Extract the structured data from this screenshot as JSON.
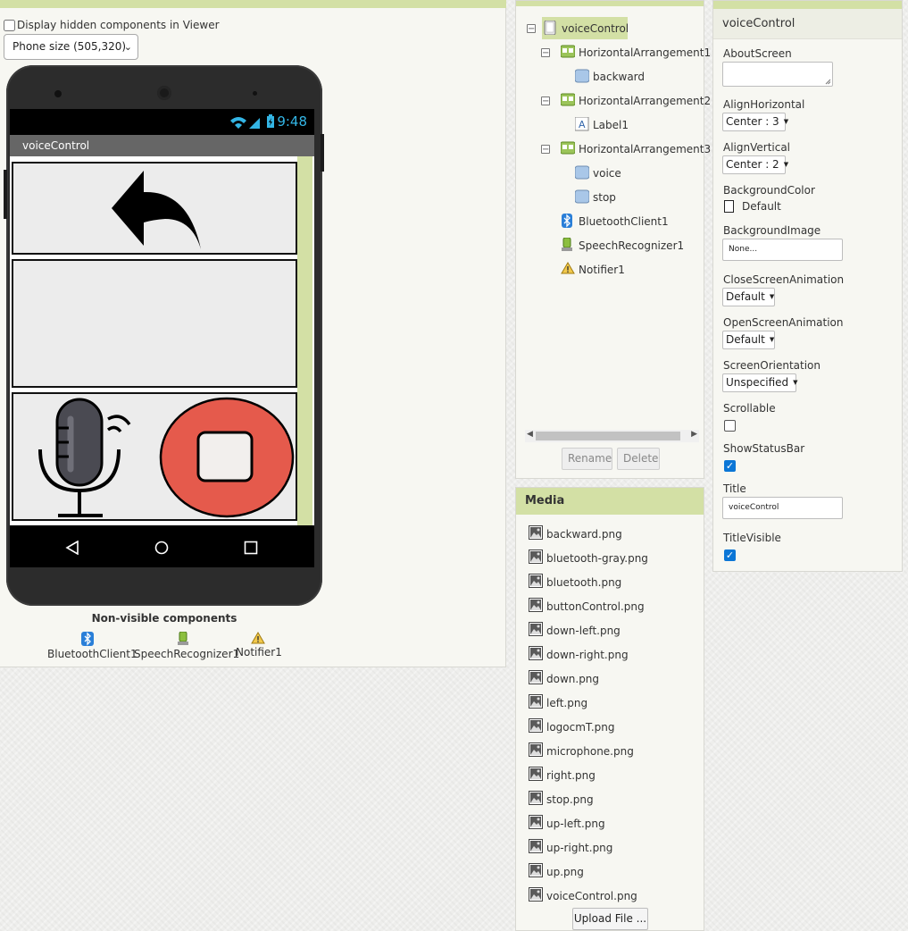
{
  "viewer": {
    "hidden_components_label": "Display hidden components in Viewer",
    "phone_size": "Phone size (505,320)",
    "status_time": "9:48",
    "screen_title": "voiceControl",
    "nonvisible_title": "Non-visible components",
    "nonvisible": [
      {
        "label": "BluetoothClient1",
        "icon": "bluetooth-icon"
      },
      {
        "label": "SpeechRecognizer1",
        "icon": "speech-icon"
      },
      {
        "label": "Notifier1",
        "icon": "warning-icon"
      }
    ],
    "images": {
      "backward": "backward-arrow-icon",
      "voice": "microphone-icon",
      "stop": "stop-icon"
    },
    "colors": {
      "accent_green": "#d3e0a5",
      "status_blue": "#33b5e5",
      "stop_red": "#e55a4c"
    }
  },
  "components": {
    "tree": [
      {
        "label": "voiceControl",
        "level": 0,
        "icon": "screen-icon",
        "toggle": "⊟"
      },
      {
        "label": "HorizontalArrangement1",
        "level": 1,
        "icon": "arrangement-icon",
        "toggle": "⊟"
      },
      {
        "label": "backward",
        "level": 2,
        "icon": "button-icon"
      },
      {
        "label": "HorizontalArrangement2",
        "level": 1,
        "icon": "arrangement-icon",
        "toggle": "⊟"
      },
      {
        "label": "Label1",
        "level": 2,
        "icon": "label-icon"
      },
      {
        "label": "HorizontalArrangement3",
        "level": 1,
        "icon": "arrangement-icon",
        "toggle": "⊟"
      },
      {
        "label": "voice",
        "level": 2,
        "icon": "button-icon"
      },
      {
        "label": "stop",
        "level": 2,
        "icon": "button-icon"
      },
      {
        "label": "BluetoothClient1",
        "level": 1,
        "icon": "bluetooth-icon"
      },
      {
        "label": "SpeechRecognizer1",
        "level": 1,
        "icon": "speech-icon"
      },
      {
        "label": "Notifier1",
        "level": 1,
        "icon": "warning-icon"
      }
    ],
    "rename_label": "Rename",
    "delete_label": "Delete"
  },
  "media": {
    "title": "Media",
    "files": [
      "backward.png",
      "bluetooth-gray.png",
      "bluetooth.png",
      "buttonControl.png",
      "down-left.png",
      "down-right.png",
      "down.png",
      "left.png",
      "logocmT.png",
      "microphone.png",
      "right.png",
      "stop.png",
      "up-left.png",
      "up-right.png",
      "up.png",
      "voiceControl.png"
    ],
    "upload_label": "Upload File ..."
  },
  "properties": {
    "component": "voiceControl",
    "about_screen_label": "AboutScreen",
    "align_horizontal_label": "AlignHorizontal",
    "align_horizontal_value": "Center : 3",
    "align_vertical_label": "AlignVertical",
    "align_vertical_value": "Center : 2",
    "background_color_label": "BackgroundColor",
    "background_color_value": "Default",
    "background_image_label": "BackgroundImage",
    "background_image_value": "None...",
    "close_anim_label": "CloseScreenAnimation",
    "close_anim_value": "Default",
    "open_anim_label": "OpenScreenAnimation",
    "open_anim_value": "Default",
    "orientation_label": "ScreenOrientation",
    "orientation_value": "Unspecified",
    "scrollable_label": "Scrollable",
    "scrollable": false,
    "statusbar_label": "ShowStatusBar",
    "statusbar": true,
    "title_label": "Title",
    "title_value": "voiceControl",
    "title_visible_label": "TitleVisible",
    "title_visible": true
  }
}
